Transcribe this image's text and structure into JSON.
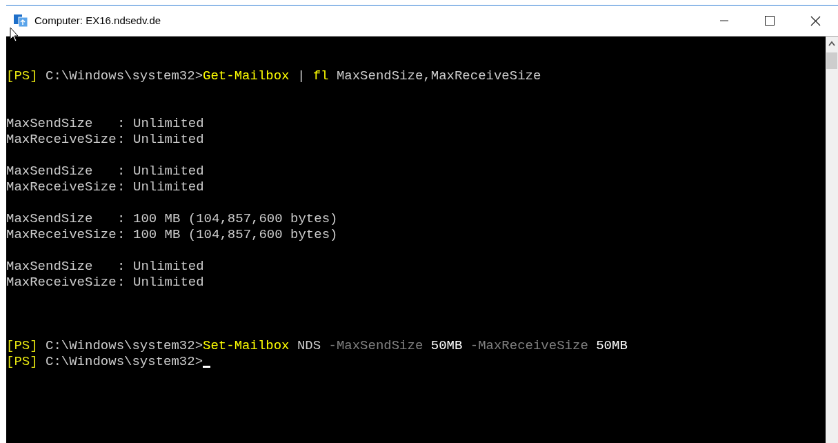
{
  "window": {
    "title": "Computer: EX16.ndsedv.de"
  },
  "console": {
    "entries": [
      {
        "kind": "command",
        "segments": [
          {
            "kind": "prompt",
            "text": "[PS]"
          },
          {
            "kind": "path",
            "text": " C:\\Windows\\system32>"
          },
          {
            "kind": "cmdlet",
            "text": "Get-Mailbox"
          },
          {
            "kind": "plain",
            "text": " | "
          },
          {
            "kind": "cmdlet",
            "text": "fl"
          },
          {
            "kind": "plain",
            "text": " MaxSendSize,MaxReceiveSize"
          }
        ]
      },
      {
        "kind": "record",
        "fields": [
          {
            "name": "MaxSendSize",
            "separator": ":",
            "value": "Unlimited"
          },
          {
            "name": "MaxReceiveSize",
            "separator": ":",
            "value": "Unlimited"
          }
        ]
      },
      {
        "kind": "record",
        "fields": [
          {
            "name": "MaxSendSize",
            "separator": ":",
            "value": "Unlimited"
          },
          {
            "name": "MaxReceiveSize",
            "separator": ":",
            "value": "Unlimited"
          }
        ]
      },
      {
        "kind": "record",
        "fields": [
          {
            "name": "MaxSendSize",
            "separator": ":",
            "value": "100 MB (104,857,600 bytes)"
          },
          {
            "name": "MaxReceiveSize",
            "separator": ":",
            "value": "100 MB (104,857,600 bytes)"
          }
        ]
      },
      {
        "kind": "record",
        "fields": [
          {
            "name": "MaxSendSize",
            "separator": ":",
            "value": "Unlimited"
          },
          {
            "name": "MaxReceiveSize",
            "separator": ":",
            "value": "Unlimited"
          }
        ]
      },
      {
        "kind": "command",
        "segments": [
          {
            "kind": "prompt",
            "text": "[PS]"
          },
          {
            "kind": "path",
            "text": " C:\\Windows\\system32>"
          },
          {
            "kind": "cmdlet",
            "text": "Set-Mailbox"
          },
          {
            "kind": "plain",
            "text": " NDS "
          },
          {
            "kind": "param",
            "text": "-MaxSendSize"
          },
          {
            "kind": "value",
            "text": " 50MB "
          },
          {
            "kind": "param",
            "text": "-MaxReceiveSize"
          },
          {
            "kind": "value",
            "text": " 50MB"
          }
        ]
      },
      {
        "kind": "command",
        "cursor": true,
        "segments": [
          {
            "kind": "prompt",
            "text": "[PS]"
          },
          {
            "kind": "path",
            "text": " C:\\Windows\\system32>"
          }
        ]
      }
    ]
  }
}
